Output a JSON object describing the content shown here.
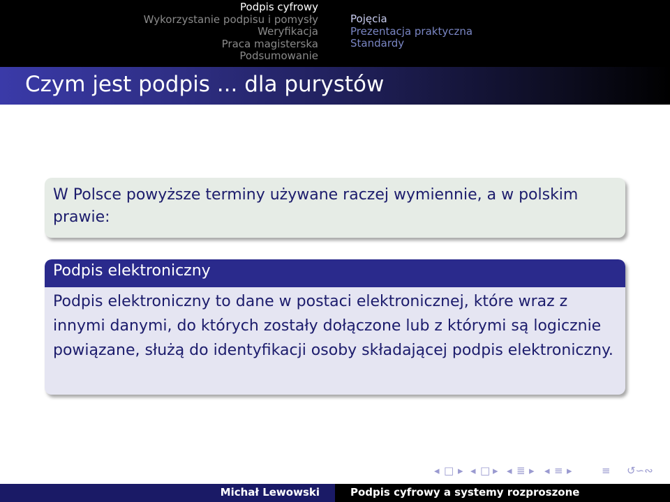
{
  "nav": {
    "sections": [
      "Podpis cyfrowy",
      "Wykorzystanie podpisu i pomysły",
      "Weryfikacja",
      "Praca magisterska",
      "Podsumowanie"
    ],
    "subsections": [
      "Pojęcia",
      "Prezentacja praktyczna",
      "Standardy"
    ]
  },
  "frame_title": "Czym jest podpis ... dla purystów",
  "intro_block": {
    "text": "W Polsce powyższe terminy używane raczej wymiennie, a w polskim prawie:"
  },
  "definition_block": {
    "title": "Podpis elektroniczny",
    "body": "Podpis elektroniczny to dane w postaci elektronicznej, które wraz z innymi danymi, do których zostały dołączone lub z którymi są logicznie powiązane, służą do identyfikacji osoby składającej podpis elektroniczny."
  },
  "beamer_nav": {
    "prev_frame": "◂",
    "frame_icon": "□",
    "next_frame": "▸",
    "prev_section": "◂",
    "section_icon": "≣",
    "next_section": "▸",
    "prev_subsection": "◂",
    "subsection_icon": "≡",
    "next_subsection": "▸",
    "align_icon": "≡",
    "search_icon": "↺∽∾"
  },
  "footer": {
    "author": "Michał Lewowski",
    "short_title": "Podpis cyfrowy a systemy rozproszone"
  }
}
